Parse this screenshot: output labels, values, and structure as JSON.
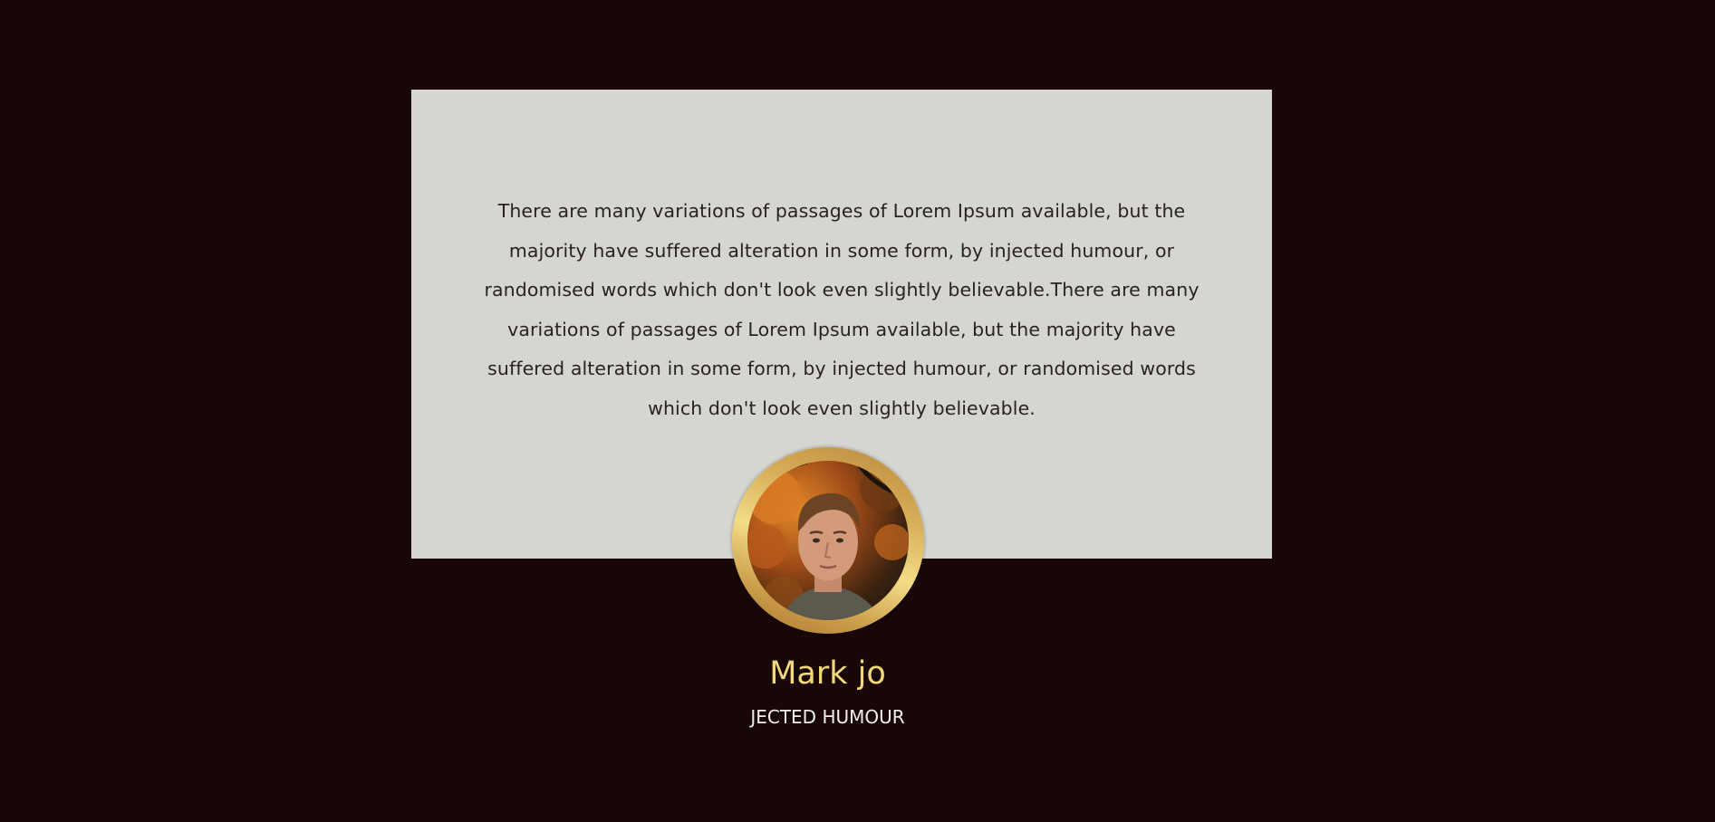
{
  "testimonial": {
    "quote": "There are many variations of passages of Lorem Ipsum available, but the majority have suffered alteration in some form, by injected humour, or randomised words which don't look even slightly believable.There are many variations of passages of Lorem Ipsum available, but the majority have suffered alteration in some form, by injected humour, or randomised words which don't look even slightly believable.",
    "name": "Mark jo",
    "role": "JECTED HUMOUR",
    "avatar_icon": "person-portrait-icon"
  },
  "colors": {
    "background": "#180706",
    "card": "#d6d6d1",
    "name": "#f3d97a",
    "ring": "#d7ad58"
  }
}
